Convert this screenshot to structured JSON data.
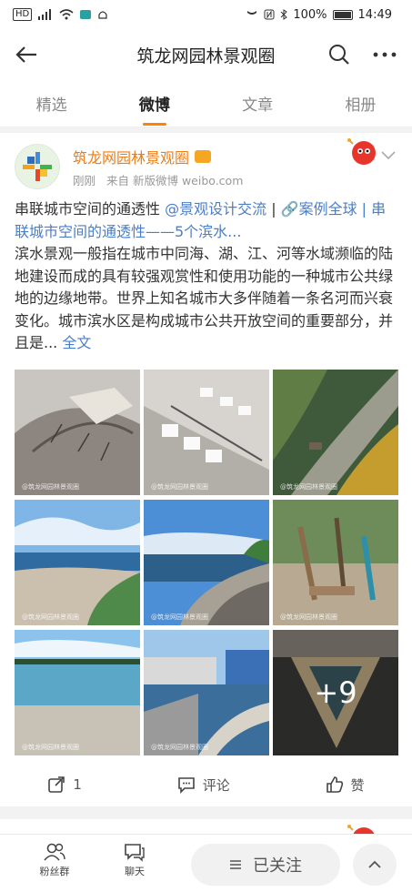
{
  "status_bar": {
    "left": "HD",
    "battery": "100%",
    "time": "14:49"
  },
  "nav": {
    "title": "筑龙网园林景观圈"
  },
  "tabs": [
    {
      "label": "精选",
      "active": false
    },
    {
      "label": "微博",
      "active": true
    },
    {
      "label": "文章",
      "active": false
    },
    {
      "label": "相册",
      "active": false
    }
  ],
  "post": {
    "author": "筑龙网园林景观圈",
    "meta_time": "刚刚",
    "meta_source": "来自 新版微博 weibo.com",
    "text_title": "串联城市空间的通透性 ",
    "text_mention": "@景观设计交流",
    "text_sep": " | ",
    "text_link": "🔗案例全球 | 串联城市空间的通透性——5个滨水...",
    "text_body": "滨水景观一般指在城市中同海、湖、江、河等水域濒临的陆地建设而成的具有较强观赏性和使用功能的一种城市公共绿地的边缘地带。世界上知名城市大多伴随着一条名河而兴衰变化。城市滨水区是构成城市公共开放空间的重要部分，并且是... ",
    "text_more": "全文",
    "photo_watermark": "@筑龙网园林景观圈",
    "more_photos": "+9",
    "repost_count": "1",
    "comment_label": "评论",
    "like_label": "赞"
  },
  "bottom_bar": {
    "fans_label": "粉丝群",
    "chat_label": "聊天",
    "follow_label": "已关注"
  },
  "colors": {
    "accent": "#ff8200",
    "link": "#4a7ec8",
    "author": "#f07c13"
  }
}
